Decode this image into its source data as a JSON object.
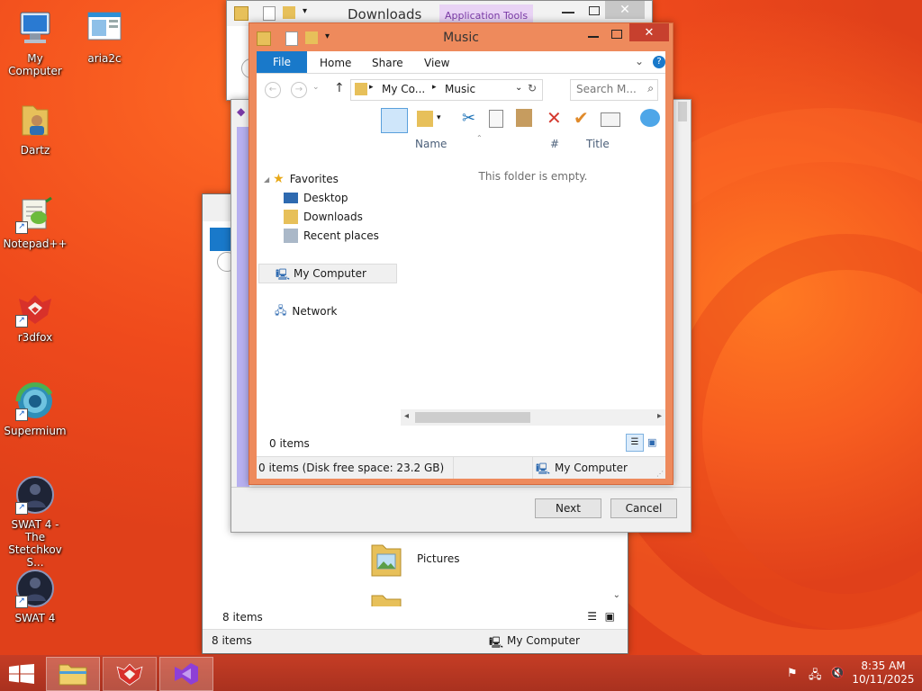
{
  "desktop": {
    "icons": [
      {
        "label": "My Computer"
      },
      {
        "label": "aria2c"
      },
      {
        "label": "Dartz"
      },
      {
        "label": "Notepad++"
      },
      {
        "label": "r3dfox"
      },
      {
        "label": "Supermium"
      },
      {
        "label": "SWAT 4 - The Stetchkov S..."
      },
      {
        "label": "SWAT 4"
      }
    ]
  },
  "downloads_window": {
    "title": "Downloads",
    "context_tab": "Application Tools"
  },
  "back_explorer": {
    "folder_pictures": "Pictures",
    "status_items": "8 items",
    "status_bar_items": "8 items",
    "status_bar_location": "My Computer"
  },
  "wizard_dialog": {
    "next_label": "Next",
    "cancel_label": "Cancel"
  },
  "music_window": {
    "title": "Music",
    "ribbon_tabs": [
      "File",
      "Home",
      "Share",
      "View"
    ],
    "breadcrumb": [
      "My Co...",
      "Music"
    ],
    "search_placeholder": "Search M...",
    "sidebar": {
      "favorites": "Favorites",
      "items": [
        "Desktop",
        "Downloads",
        "Recent places"
      ],
      "my_computer": "My Computer",
      "network": "Network"
    },
    "columns": [
      "Name",
      "#",
      "Title"
    ],
    "empty_message": "This folder is empty.",
    "item_count": "0 items",
    "status_text": "0 items (Disk free space: 23.2 GB)",
    "status_location": "My Computer"
  },
  "taskbar": {
    "time": "8:35 AM",
    "date": "10/11/2025"
  },
  "colors": {
    "accent_blue": "#1979ca",
    "title_active": "#ee8a5c",
    "close_red": "#c7402e"
  }
}
